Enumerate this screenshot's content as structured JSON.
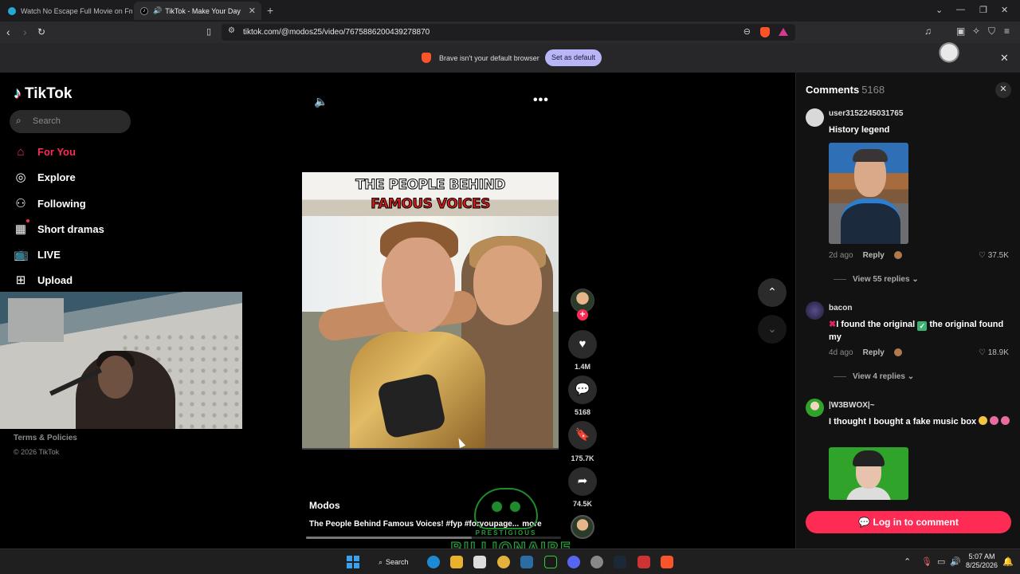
{
  "browser": {
    "tabs": [
      {
        "title": "Watch No Escape Full Movie on Fmo",
        "active": false
      },
      {
        "title": "TikTok - Make Your Day",
        "active": true
      }
    ],
    "url": "tiktok.com/@modos25/video/7675886200439278870",
    "infobar": {
      "message": "Brave isn't your default browser",
      "button": "Set as default"
    }
  },
  "sidebar": {
    "logo": "TikTok",
    "search_placeholder": "Search",
    "items": [
      {
        "label": "For You",
        "icon": "home-icon",
        "active": true
      },
      {
        "label": "Explore",
        "icon": "compass-icon",
        "active": false
      },
      {
        "label": "Following",
        "icon": "following-icon",
        "active": false
      },
      {
        "label": "Short dramas",
        "icon": "film-icon",
        "active": false
      },
      {
        "label": "LIVE",
        "icon": "tv-icon",
        "active": false
      },
      {
        "label": "Upload",
        "icon": "plus-square-icon",
        "active": false
      }
    ],
    "terms": "Terms & Policies",
    "copyright": "© 2026 TikTok"
  },
  "video": {
    "overlay_line1": "THE PEOPLE BEHIND",
    "overlay_line2": "FAMOUS VOICES",
    "author": "Modos",
    "caption": "The People Behind Famous Voices! #fyp #foryoupage...",
    "more": "more",
    "playback_fraction": 0.65,
    "watermark_line1": "PRESTIGIOUS",
    "watermark_line2": "BILLIONAIRE",
    "actions": {
      "likes": "1.4M",
      "comments": "5168",
      "saves": "175.7K",
      "shares": "74.5K"
    }
  },
  "comments": {
    "title": "Comments",
    "count": "5168",
    "items": [
      {
        "user": "user3152245031765",
        "text": "History legend",
        "age": "2d ago",
        "reply": "Reply",
        "likes": "37.5K",
        "view_replies": "View 55 replies"
      },
      {
        "user": "bacon",
        "text_a": "I found the original",
        "text_b": "the original found my",
        "age": "4d ago",
        "reply": "Reply",
        "likes": "18.9K",
        "view_replies": "View 4 replies"
      },
      {
        "user": "|W3BWOX|~",
        "text": "I thought I bought a fake music box"
      }
    ],
    "login": "Log in to comment"
  },
  "taskbar": {
    "search": "Search",
    "time": "5:07 AM",
    "date": "8/25/2026"
  },
  "colors": {
    "accent": "#fe2c55",
    "panel_bg": "#121212",
    "infobar_button": "#b8b6f7"
  }
}
